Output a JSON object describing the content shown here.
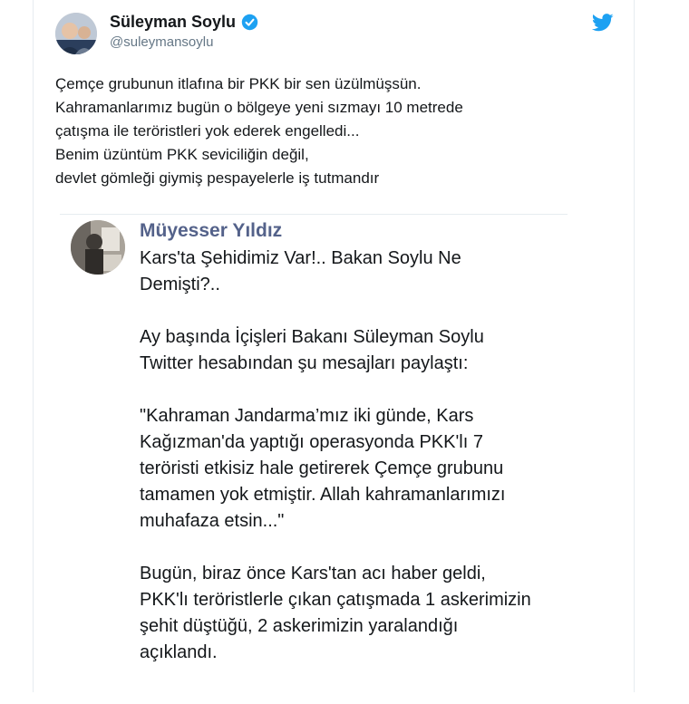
{
  "tweet": {
    "author_name": "Süleyman Soylu",
    "author_handle": "@suleymansoylu",
    "lines": [
      "Çemçe grubunun itlafına bir PKK bir sen üzülmüşsün.",
      "Kahramanlarımız bugün o bölgeye yeni sızmayı 10 metrede",
      "çatışma ile teröristleri yok ederek engelledi...",
      "Benim üzüntüm PKK seviciliğin değil,",
      "devlet gömleği giymiş pespayelerle iş tutmandır"
    ]
  },
  "quote": {
    "author_name": "Müyesser Yıldız",
    "paragraphs": [
      [
        "Kars'ta Şehidimiz Var!.. Bakan Soylu Ne",
        "Demişti?.."
      ],
      [
        "Ay başında İçişleri Bakanı Süleyman Soylu",
        "Twitter hesabından şu mesajları paylaştı:"
      ],
      [
        "\"Kahraman Jandarma’mız iki günde, Kars",
        "Kağızman'da yaptığı operasyonda PKK'lı 7",
        "teröristi etkisiz hale getirerek Çemçe grubunu",
        "tamamen yok etmiştir. Allah kahramanlarımızı",
        "muhafaza etsin...\""
      ],
      [
        "Bugün, biraz önce Kars'tan acı haber geldi,",
        "PKK'lı teröristlerle çıkan çatışmada 1 askerimizin",
        "şehit düştüğü, 2 askerimizin yaralandığı",
        "açıklandı."
      ]
    ]
  },
  "icons": {
    "verified": "verified-badge-icon",
    "platform": "twitter-bird-icon"
  },
  "colors": {
    "accent": "#1da1f2",
    "quote_author": "#54628a",
    "handle": "#657786"
  }
}
